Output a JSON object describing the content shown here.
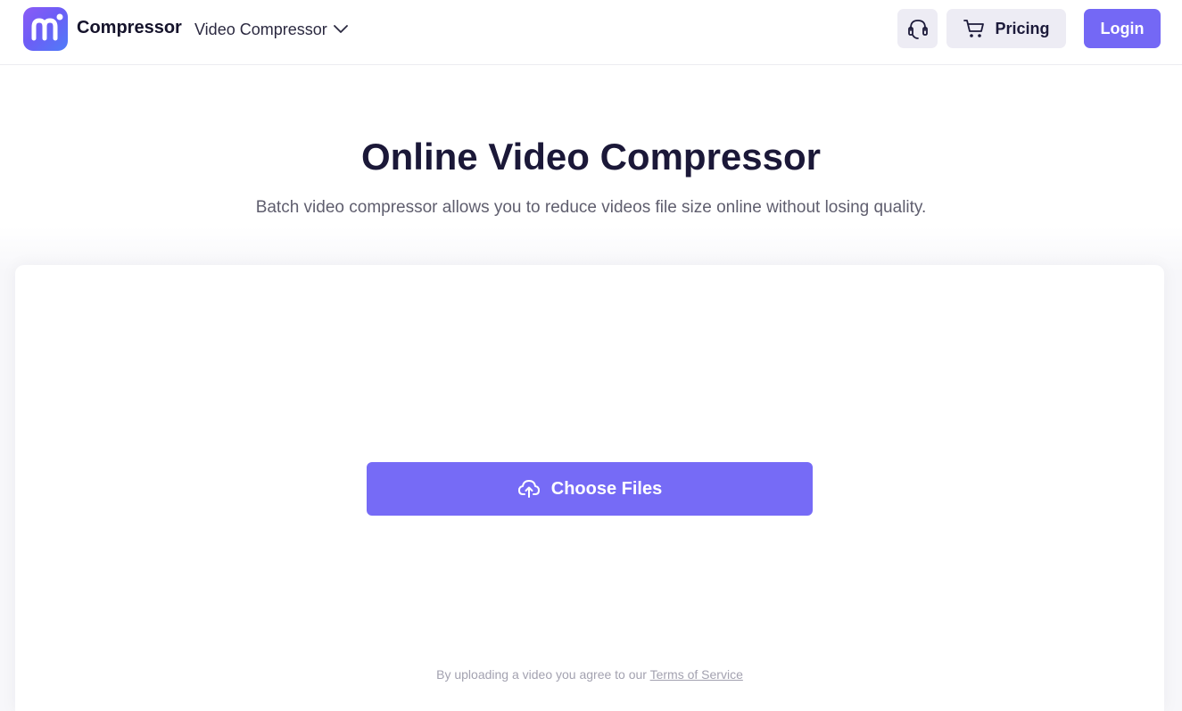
{
  "header": {
    "brand": "Compressor",
    "product_menu": "Video Compressor",
    "pricing_label": "Pricing",
    "login_label": "Login"
  },
  "hero": {
    "title": "Online Video Compressor",
    "subtitle": "Batch video compressor allows you to reduce videos file size online without losing quality."
  },
  "upload": {
    "button_label": "Choose Files",
    "terms_prefix": "By uploading a video you agree to our ",
    "terms_link": "Terms of Service"
  },
  "icons": {
    "logo": "media-io-logo",
    "dropdown": "chevron-down-icon",
    "support": "headset-icon",
    "cart": "cart-icon",
    "upload": "cloud-upload-icon"
  },
  "colors": {
    "accent": "#7468f5",
    "secondary_button_bg": "#edecf4",
    "title": "#1b1838",
    "muted_text": "#5f5e6e"
  }
}
